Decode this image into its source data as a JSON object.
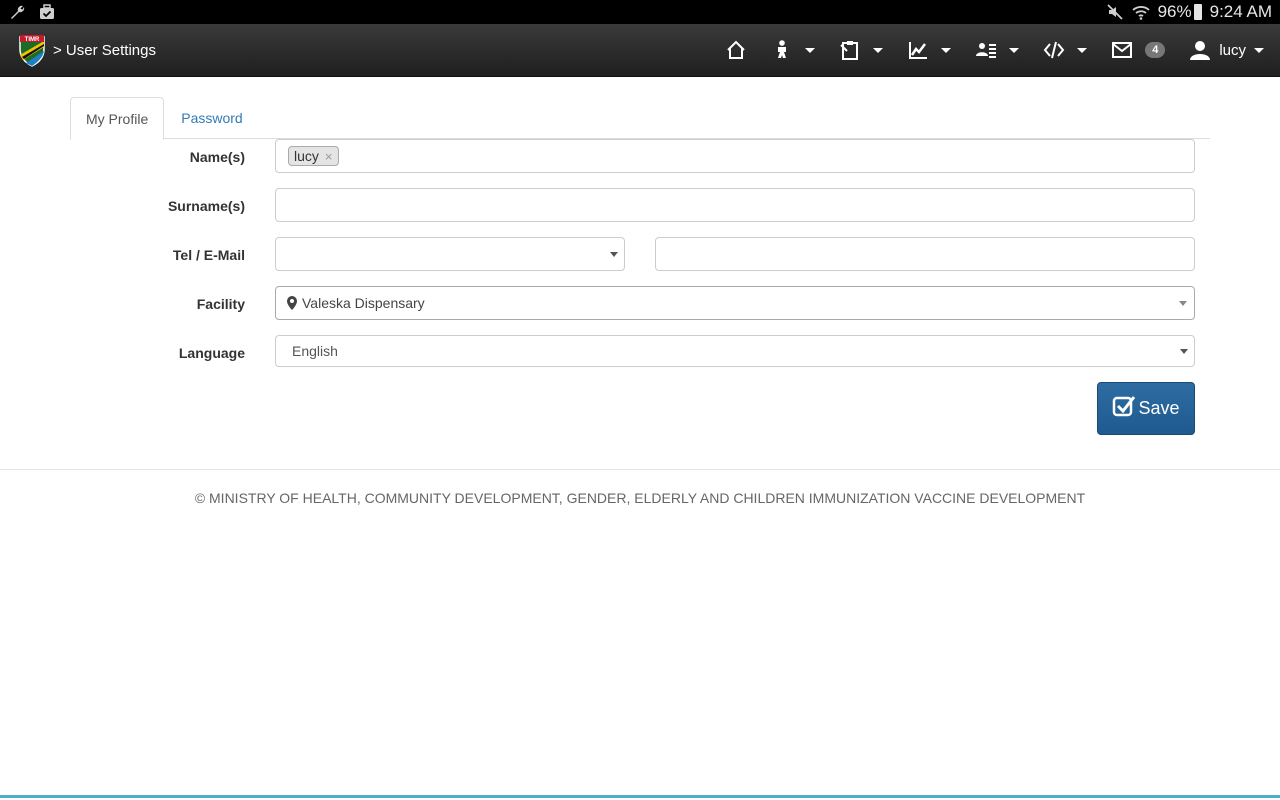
{
  "status_bar": {
    "battery": "96%",
    "time": "9:24 AM"
  },
  "navbar": {
    "title": "> User Settings",
    "messages_count": "4",
    "username": "lucy"
  },
  "tabs": [
    {
      "label": "My Profile",
      "active": true
    },
    {
      "label": "Password",
      "active": false
    }
  ],
  "form": {
    "names_label": "Name(s)",
    "names_tags": [
      "lucy"
    ],
    "surname_label": "Surname(s)",
    "surname_value": "",
    "contact_label": "Tel / E-Mail",
    "contact_type_value": "",
    "contact_value": "",
    "facility_label": "Facility",
    "facility_value": "Valeska Dispensary",
    "language_label": "Language",
    "language_value": "English",
    "save_label": "Save"
  },
  "footer": {
    "text": "© MINISTRY OF HEALTH, COMMUNITY DEVELOPMENT, GENDER, ELDERLY AND CHILDREN IMMUNIZATION VACCINE DEVELOPMENT"
  },
  "colors": {
    "navbar": "#2b2b2b",
    "link": "#337ab7",
    "primary_button": "#2a6496",
    "accent_line": "#4ab0c8"
  }
}
